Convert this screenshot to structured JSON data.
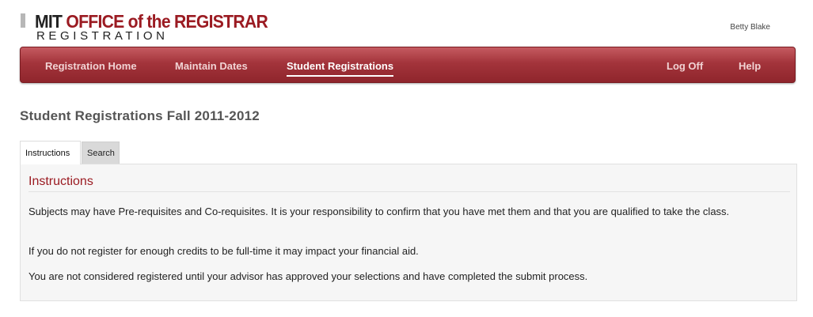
{
  "header": {
    "logo_mit": "MIT",
    "logo_office": "OFFICE of the REGISTRAR",
    "logo_sub": "REGISTRATION",
    "user_name": "Betty Blake"
  },
  "nav": {
    "items": [
      {
        "label": "Registration Home"
      },
      {
        "label": "Maintain Dates"
      },
      {
        "label": "Student Registrations"
      }
    ],
    "right_items": [
      {
        "label": "Log Off"
      },
      {
        "label": "Help"
      }
    ],
    "active": "Student Registrations"
  },
  "page": {
    "title": "Student Registrations Fall 2011-2012"
  },
  "tabs": [
    {
      "label": "Instructions",
      "selected": true
    },
    {
      "label": "Search",
      "selected": false
    }
  ],
  "panel": {
    "heading": "Instructions",
    "paragraphs": [
      "Subjects may have Pre-requisites and Co-requisites. It is your responsibility to confirm that you have met them and that you are qualified to take the class.",
      "If you do not register for enough credits to be full-time it may impact your financial aid.",
      "You are not considered registered until your advisor has approved your selections and have completed the submit process."
    ]
  },
  "colors": {
    "brand": "#9b1b22",
    "nav_top": "#c55a60",
    "nav_bottom": "#8f252c"
  }
}
